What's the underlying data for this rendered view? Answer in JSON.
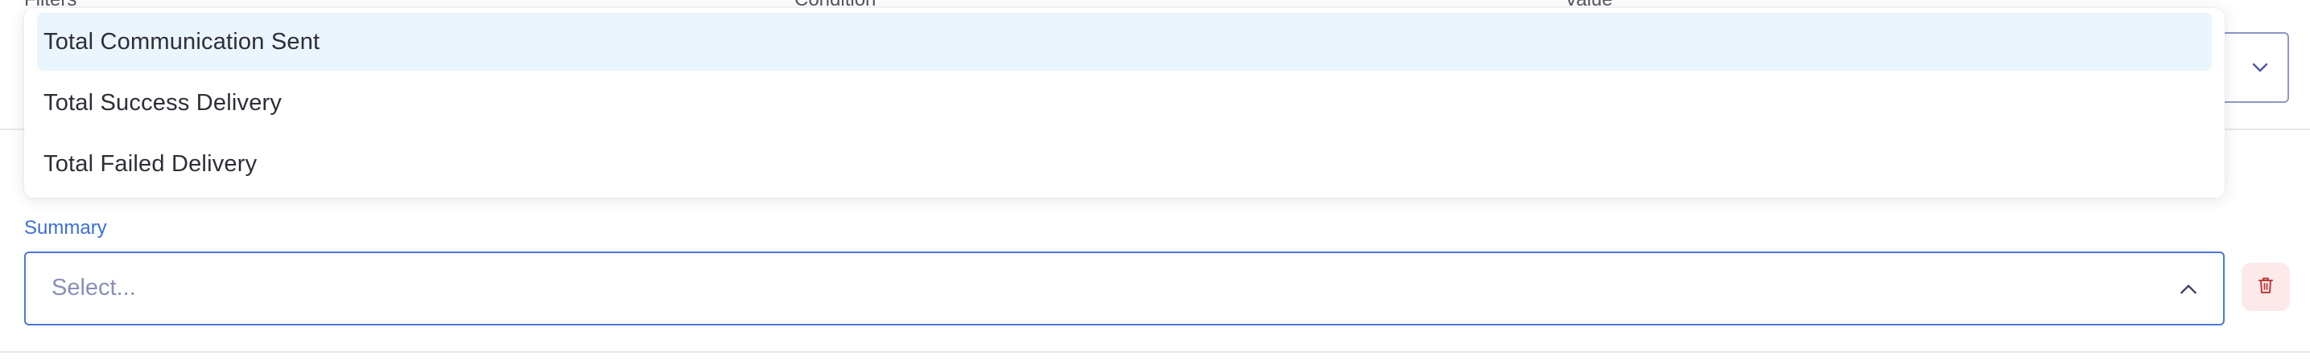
{
  "filter_row": {
    "filters_label": "Filters *",
    "condition_label": "Condition *",
    "value_label": "Value *",
    "value_chevron_icon": "chevron-down-icon"
  },
  "dropdown": {
    "options": [
      "Total Communication Sent",
      "Total Success Delivery",
      "Total Failed Delivery"
    ],
    "highlighted_index": 0
  },
  "summary": {
    "label": "Summary",
    "placeholder": "Select...",
    "chevron_icon": "chevron-up-icon",
    "delete_icon": "trash-icon"
  },
  "colors": {
    "accent": "#3b6fd6",
    "highlight": "#eaf5fd",
    "delete_bg": "#fde9ea",
    "delete_icon": "#c23a3a"
  }
}
